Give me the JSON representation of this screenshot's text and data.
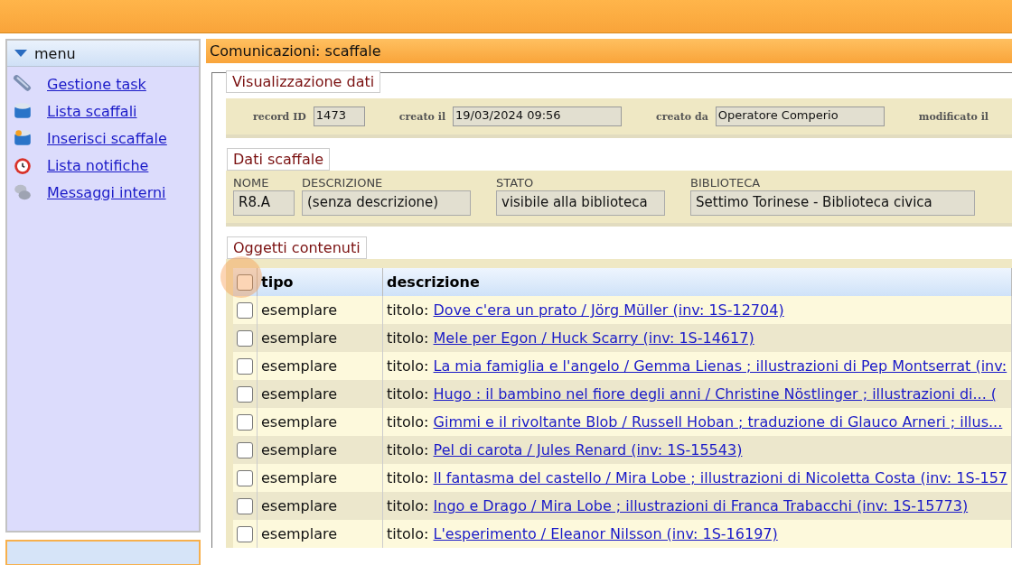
{
  "sidebar": {
    "title": "menu",
    "expanded": true,
    "items": [
      {
        "label": "Gestione task"
      },
      {
        "label": "Lista scaffali"
      },
      {
        "label": "Inserisci scaffale"
      },
      {
        "label": "Lista notifiche"
      },
      {
        "label": "Messaggi interni"
      }
    ]
  },
  "page_title": "Comunicazioni: scaffale",
  "data_view": {
    "legend": "Visualizzazione dati",
    "fields": [
      {
        "label": "record ID",
        "value": "1473"
      },
      {
        "label": "creato il",
        "value": "19/03/2024 09:56"
      },
      {
        "label": "creato da",
        "value": "Operatore Comperio"
      },
      {
        "label": "modificato il"
      }
    ]
  },
  "shelf": {
    "legend": "Dati scaffale",
    "fields": [
      {
        "label": "NOME",
        "value": "R8.A"
      },
      {
        "label": "DESCRIZIONE",
        "value": "(senza descrizione)"
      },
      {
        "label": "STATO",
        "value": "visibile alla biblioteca"
      },
      {
        "label": "BIBLIOTECA",
        "value": "Settimo Torinese - Biblioteca civica"
      }
    ]
  },
  "contents": {
    "legend": "Oggetti contenuti",
    "select_all_checked": false,
    "columns": [
      "tipo",
      "descrizione"
    ],
    "rows": [
      {
        "checked": false,
        "type": "esemplare",
        "prefix": "titolo:",
        "title": "Dove c'era un prato / Jörg Müller (inv: 1S-12704)"
      },
      {
        "checked": false,
        "type": "esemplare",
        "prefix": "titolo:",
        "title": "Mele per Egon / Huck Scarry (inv: 1S-14617)"
      },
      {
        "checked": false,
        "type": "esemplare",
        "prefix": "titolo:",
        "title": "La mia famiglia e l'angelo / Gemma Lienas ; illustrazioni di Pep Montserrat (inv:"
      },
      {
        "checked": false,
        "type": "esemplare",
        "prefix": "titolo:",
        "title": "Hugo : il bambino nel fiore degli anni / Christine Nöstlinger ; illustrazioni di... ("
      },
      {
        "checked": false,
        "type": "esemplare",
        "prefix": "titolo:",
        "title": "Gimmi e il rivoltante Blob / Russell Hoban ; traduzione di Glauco Arneri ; illus..."
      },
      {
        "checked": false,
        "type": "esemplare",
        "prefix": "titolo:",
        "title": "Pel di carota / Jules Renard (inv: 1S-15543)"
      },
      {
        "checked": false,
        "type": "esemplare",
        "prefix": "titolo:",
        "title": "Il fantasma del castello / Mira Lobe ; illustrazioni di Nicoletta Costa (inv: 1S-157"
      },
      {
        "checked": false,
        "type": "esemplare",
        "prefix": "titolo:",
        "title": "Ingo e Drago / Mira Lobe ; illustrazioni di Franca Trabacchi (inv: 1S-15773)"
      },
      {
        "checked": false,
        "type": "esemplare",
        "prefix": "titolo:",
        "title": "L'esperimento / Eleanor Nilsson (inv: 1S-16197)"
      }
    ]
  }
}
